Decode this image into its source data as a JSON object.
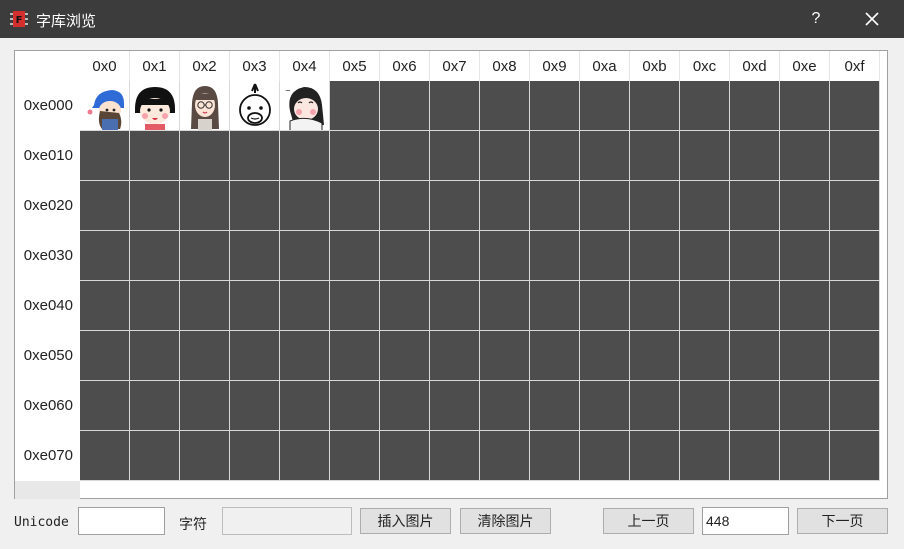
{
  "window": {
    "title": "字库浏览",
    "help_label": "?",
    "app_icon": "font-chip-icon",
    "accent_color": "#d32f2f"
  },
  "grid": {
    "col_headers": [
      "0x0",
      "0x1",
      "0x2",
      "0x3",
      "0x4",
      "0x5",
      "0x6",
      "0x7",
      "0x8",
      "0x9",
      "0xa",
      "0xb",
      "0xc",
      "0xd",
      "0xe",
      "0xf"
    ],
    "row_headers": [
      "0xe000",
      "0xe010",
      "0xe020",
      "0xe030",
      "0xe040",
      "0xe050",
      "0xe060",
      "0xe070"
    ],
    "filled_cells": [
      {
        "row": 0,
        "col": 0,
        "glyph": "girl-blue-hat-icon"
      },
      {
        "row": 0,
        "col": 1,
        "glyph": "chibi-maruko-icon"
      },
      {
        "row": 0,
        "col": 2,
        "glyph": "girl-glasses-icon"
      },
      {
        "row": 0,
        "col": 3,
        "glyph": "bald-man-icon"
      },
      {
        "row": 0,
        "col": 4,
        "glyph": "girl-scarf-icon"
      }
    ],
    "empty_color": "#4d4d4d"
  },
  "bottom": {
    "unicode_label": "Unicode",
    "unicode_value": "",
    "char_label": "字符",
    "char_value": "",
    "insert_button": "插入图片",
    "clear_button": "清除图片",
    "prev_button": "上一页",
    "page_value": "448",
    "next_button": "下一页"
  }
}
